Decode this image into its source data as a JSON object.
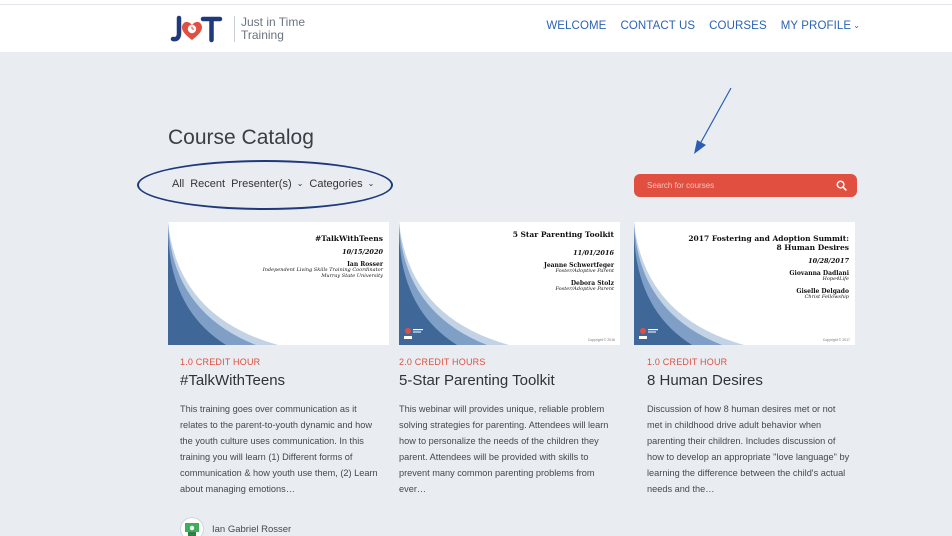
{
  "brand": {
    "line1": "Just in Time",
    "line2": "Training"
  },
  "nav": {
    "items": [
      "WELCOME",
      "CONTACT US",
      "COURSES",
      "MY PROFILE"
    ]
  },
  "page": {
    "title": "Course Catalog"
  },
  "filters": {
    "all": "All",
    "recent": "Recent",
    "presenters": "Presenter(s)",
    "categories": "Categories"
  },
  "search": {
    "placeholder": "Search for courses"
  },
  "colors": {
    "accent": "#e04f40",
    "nav": "#2c63b5",
    "background": "#e9edf2",
    "annotation": "#1f3a7a"
  },
  "courses": [
    {
      "credit": "1.0 CREDIT HOUR",
      "title": "#TalkWithTeens",
      "description": "This training goes over communication as it relates to the parent-to-youth dynamic and how the youth culture uses communication. In this training you will learn (1) Different forms of communication & how youth use them, (2) Learn about managing emotions…",
      "thumb": {
        "title": "#TalkWithTeens",
        "date": "10/15/2020",
        "presenter1": "Ian Rosser",
        "role1a": "Independent Living Skills Training Coordinator",
        "role1b": "Murray State University"
      }
    },
    {
      "credit": "2.0 CREDIT HOURS",
      "title": "5-Star Parenting Toolkit",
      "description": "This webinar will provides unique, reliable problem solving strategies for parenting. Attendees will learn how to personalize the needs of the children they parent. Attendees will be provided with skills to prevent many common parenting problems from ever…",
      "thumb": {
        "title": "5 Star Parenting Toolkit",
        "date": "11/01/2016",
        "presenter1": "Jeanne Schwertfeger",
        "role1": "Foster/Adoptive Parent",
        "presenter2": "Debora Stolz",
        "role2": "Foster/Adoptive Parent",
        "copyright": "Copyright © 2016"
      }
    },
    {
      "credit": "1.0 CREDIT HOUR",
      "title": "8 Human Desires",
      "description": "Discussion of how 8 human desires met or not met in childhood drive adult behavior when parenting their children. Includes discussion of how to develop an appropriate \"love language\" by learning the difference between the child's actual needs and the…",
      "thumb": {
        "title1": "2017 Fostering and Adoption Summit:",
        "title2": "8 Human Desires",
        "date": "10/28/2017",
        "presenter1": "Giovanna Dadlani",
        "role1": "Hope4Life",
        "presenter2": "Giselle Delgado",
        "role2": "Christ Fellowship",
        "copyright": "Copyright © 2017"
      }
    }
  ],
  "presenter": {
    "name": "Ian Gabriel Rosser"
  }
}
